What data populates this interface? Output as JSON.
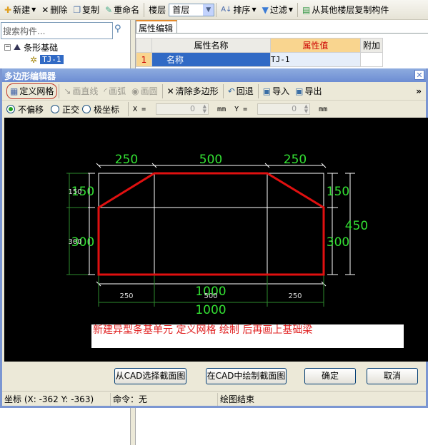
{
  "toolbar": {
    "new": "新建",
    "delete": "删除",
    "copy": "复制",
    "rename": "重命名",
    "floor_label": "楼层",
    "floor_value": "首层",
    "sort": "排序",
    "filter": "过滤",
    "copy_from_floor": "从其他楼层复制构件"
  },
  "left": {
    "search_placeholder": "搜索构件...",
    "tree_root": "条形基础",
    "tree_child": "TJ-1"
  },
  "props": {
    "tab": "属性编辑",
    "headers": [
      "属性名称",
      "属性值",
      "附加"
    ],
    "rows": [
      {
        "num": "1",
        "name": "名称",
        "value": "TJ-1",
        "extra": ""
      }
    ]
  },
  "dialog": {
    "title": "多边形编辑器",
    "tools": {
      "define_grid": "定义网格",
      "draw_line": "画直线",
      "draw_arc": "画弧",
      "draw_circle": "画圆",
      "clear": "清除多边形",
      "undo": "回退",
      "import": "导入",
      "export": "导出",
      "more": "»"
    },
    "options": {
      "no_offset": "不偏移",
      "ortho": "正交",
      "polar": "极坐标",
      "x_label": "X =",
      "x_value": "0",
      "y_label": "Y =",
      "y_value": "0",
      "unit": "mm"
    },
    "drawing": {
      "top_dims": [
        "250",
        "500",
        "250"
      ],
      "right_dims": [
        "150",
        "300"
      ],
      "right_total": "450",
      "left_dims": [
        "150",
        "300"
      ],
      "left_small": [
        "150",
        "300"
      ],
      "bottom_total": "1000",
      "bottom_small": [
        "250",
        "500",
        "250"
      ],
      "bottom_total2": "1000"
    },
    "note": "新建异型条基单元 定义网格 绘制 后再画上基础梁",
    "buttons": {
      "from_cad": "从CAD选择截面图",
      "draw_in_cad": "在CAD中绘制截面图",
      "ok": "确定",
      "cancel": "取消"
    },
    "status": {
      "coords": "坐标 (X: -362 Y: -363)",
      "command": "命令：无",
      "message": "绘图结束"
    }
  },
  "colors": {
    "polygon": "#e01010",
    "dim_text": "#33e033",
    "grid": "#ffffff"
  }
}
